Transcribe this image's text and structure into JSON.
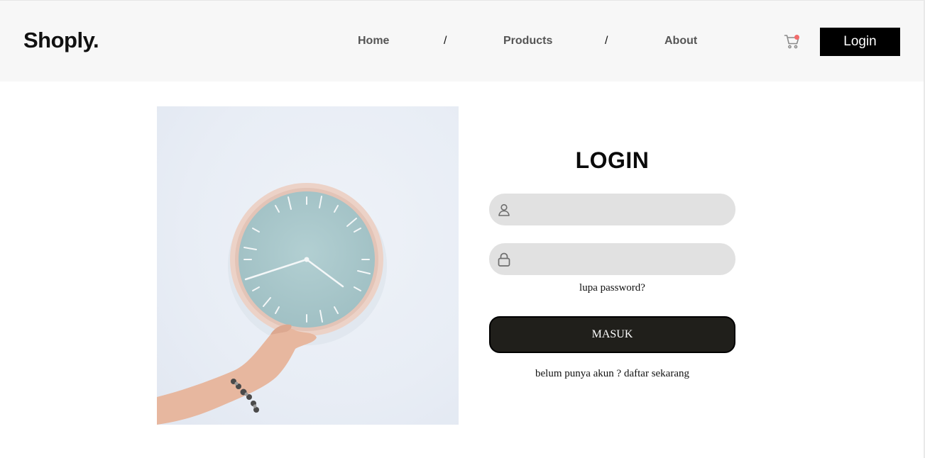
{
  "header": {
    "logo": "Shoply.",
    "nav": [
      {
        "label": "Home"
      },
      {
        "label": "Products"
      },
      {
        "label": "About"
      }
    ],
    "separator": "/",
    "cart_icon": "cart-icon",
    "login_label": "Login"
  },
  "hero": {
    "image": "wall-clock-photo"
  },
  "form": {
    "title": "LOGIN",
    "username": {
      "icon": "user-icon",
      "value": "",
      "placeholder": ""
    },
    "password": {
      "icon": "lock-icon",
      "value": "",
      "placeholder": ""
    },
    "forgot_label": "lupa password?",
    "submit_label": "MASUK",
    "register_label": "belum punya akun ? daftar sekarang"
  },
  "colors": {
    "header_bg": "#f7f7f7",
    "accent": "#000000",
    "field_bg": "#e1e1e1",
    "submit_bg": "#201f1b",
    "badge": "#f26b6b",
    "clock_face": "#a9c7ca",
    "clock_rim": "#e9c9bd"
  }
}
